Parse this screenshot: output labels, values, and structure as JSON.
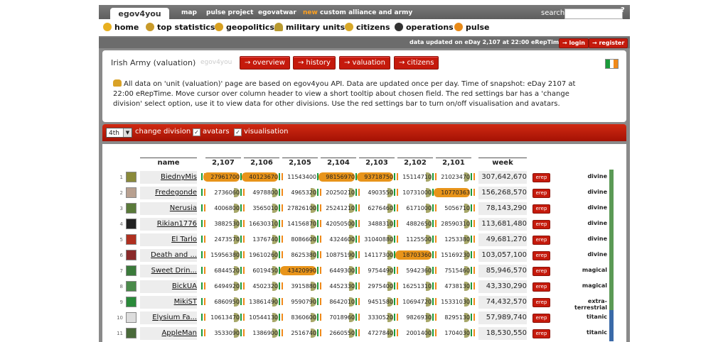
{
  "topbar": {
    "brand": "egov4you",
    "links": [
      "map",
      "pulse project",
      "egovatwar"
    ],
    "new_tag": "new",
    "new_link": "custom alliance and army",
    "search_label": "search",
    "help": "?"
  },
  "nav": [
    {
      "label": "home",
      "icon": "smiley-icon"
    },
    {
      "label": "top statistics",
      "icon": "trophy-icon"
    },
    {
      "label": "geopolitics",
      "icon": "globe-icon"
    },
    {
      "label": "military units",
      "icon": "helmet-icon"
    },
    {
      "label": "citizens",
      "icon": "citizen-icon"
    },
    {
      "label": "operations",
      "icon": "bomb-icon"
    },
    {
      "label": "pulse",
      "icon": "pulse-icon"
    }
  ],
  "status": {
    "updated": "data updated on eDay 2,107 at 22:00 eRepTime",
    "login": "→ login",
    "register": "→ register"
  },
  "unit": {
    "title": "Irish Army (valuation)",
    "subtitle": "egov4you",
    "buttons": [
      "→ overview",
      "→ history",
      "→ valuation",
      "→ citizens"
    ],
    "description": "All data on 'unit (valuation)' page are based on egov4you API. Data are updated once per day. Time of snapshot: eDay 2107 at 22:00 eRepTime. Move cursor over column header to view a short tooltip about chosen field. The red settings bar has a 'change division' select option, use it to view data for other divisions. Use the red settings bar to turn on/off visualisation and avatars."
  },
  "settings": {
    "division": "4th",
    "change_division": "change division",
    "avatars": "avatars",
    "visualisation": "visualisation",
    "check": "✓"
  },
  "table": {
    "headers": {
      "name": "name",
      "days": [
        "2,107",
        "2,106",
        "2,105",
        "2,104",
        "2,103",
        "2,102",
        "2,101"
      ],
      "week": "week"
    },
    "erep_label": "erep",
    "rows": [
      {
        "num": "1",
        "name": "BiednyMis",
        "vals": [
          "27961700",
          "40123670",
          "11543400",
          "98156970",
          "93718750",
          "15114710",
          "21023470"
        ],
        "hl": [
          2,
          2,
          0,
          2,
          2,
          1,
          1
        ],
        "week": "307,642,670",
        "tier": "divine",
        "tierColor": "#5b9a56",
        "avatarColor": "#8a8a3a"
      },
      {
        "num": "2",
        "name": "Fredegonde",
        "vals": [
          "2736060",
          "4978800",
          "4965320",
          "20250210",
          "4903550",
          "10731000",
          "10770363"
        ],
        "hl": [
          1,
          1,
          1,
          1,
          1,
          1,
          2
        ],
        "week": "156,268,570",
        "tier": "divine",
        "tierColor": "#5b9a56",
        "avatarColor": "#b8a090"
      },
      {
        "num": "3",
        "name": "Nerusia",
        "vals": [
          "4006800",
          "3565010",
          "27826100",
          "25241210",
          "6276460",
          "6171000",
          "5056710"
        ],
        "hl": [
          1,
          1,
          1,
          1,
          1,
          1,
          1
        ],
        "week": "78,143,290",
        "tier": "divine",
        "tierColor": "#5b9a56",
        "avatarColor": "#5a7a3a"
      },
      {
        "num": "4",
        "name": "Rikian1776",
        "vals": [
          "3882530",
          "16630310",
          "14156870",
          "42050500",
          "3488310",
          "4882650",
          "28590310"
        ],
        "hl": [
          1,
          1,
          1,
          1,
          1,
          1,
          1
        ],
        "week": "113,681,480",
        "tier": "divine",
        "tierColor": "#5b9a56",
        "avatarColor": "#222222"
      },
      {
        "num": "5",
        "name": "El Tarlo",
        "vals": [
          "2473570",
          "1376740",
          "8086600",
          "4324600",
          "31040880",
          "1125500",
          "1253380"
        ],
        "hl": [
          1,
          1,
          1,
          1,
          1,
          1,
          1
        ],
        "week": "49,681,270",
        "tier": "divine",
        "tierColor": "#5b9a56",
        "avatarColor": "#b03020"
      },
      {
        "num": "6",
        "name": "Death and ...",
        "vals": [
          "15956380",
          "19610260",
          "8625380",
          "10875190",
          "14117300",
          "18703360",
          "15169230"
        ],
        "hl": [
          1,
          1,
          1,
          1,
          1,
          2,
          1
        ],
        "week": "103,057,100",
        "tier": "divine",
        "tierColor": "#5b9a56",
        "avatarColor": "#8a2a2a"
      },
      {
        "num": "7",
        "name": "Sweet Drin...",
        "vals": [
          "6844520",
          "6019450",
          "43420990",
          "6449300",
          "9754490",
          "5942360",
          "7515460"
        ],
        "hl": [
          1,
          1,
          2,
          1,
          1,
          1,
          1
        ],
        "week": "85,946,570",
        "tier": "magical",
        "tierColor": "#5b9a56",
        "avatarColor": "#3a7a3a"
      },
      {
        "num": "8",
        "name": "BickUA",
        "vals": [
          "6494920",
          "4502320",
          "3915880",
          "4452330",
          "2975400",
          "16251310",
          "4738130"
        ],
        "hl": [
          1,
          1,
          1,
          1,
          1,
          1,
          1
        ],
        "week": "43,330,290",
        "tier": "magical",
        "tierColor": "#5b9a56",
        "avatarColor": "#4a8a4a"
      },
      {
        "num": "9",
        "name": "MikiST",
        "vals": [
          "6860950",
          "13861490",
          "9590790",
          "8642010",
          "9451580",
          "10694720",
          "15331030"
        ],
        "hl": [
          1,
          1,
          1,
          1,
          1,
          1,
          1
        ],
        "week": "74,432,570",
        "tier": "extra-terrestrial",
        "tierColor": "#5b9a56",
        "avatarColor": "#2a8a3a"
      },
      {
        "num": "10",
        "name": "Elysium Fa...",
        "vals": [
          "10613470",
          "10544130",
          "8360600",
          "7018960",
          "3330520",
          "9826930",
          "8295130"
        ],
        "hl": [
          1,
          1,
          1,
          1,
          1,
          1,
          1
        ],
        "week": "57,989,740",
        "tier": "titanic",
        "tierColor": "#3a6aa8",
        "avatarColor": "#dddddd"
      },
      {
        "num": "11",
        "name": "AppleMan",
        "vals": [
          "3533090",
          "1386900",
          "2516740",
          "2660550",
          "4727840",
          "2001400",
          "1704030"
        ],
        "hl": [
          1,
          1,
          1,
          1,
          1,
          1,
          1
        ],
        "week": "18,530,550",
        "tier": "titanic",
        "tierColor": "#3a6aa8",
        "avatarColor": "#4a6a3a"
      }
    ]
  },
  "colors": {
    "accent_red": "#c51a0c",
    "highlight_orange": "#e8941a",
    "highlight_olive": "#a8a86a"
  }
}
